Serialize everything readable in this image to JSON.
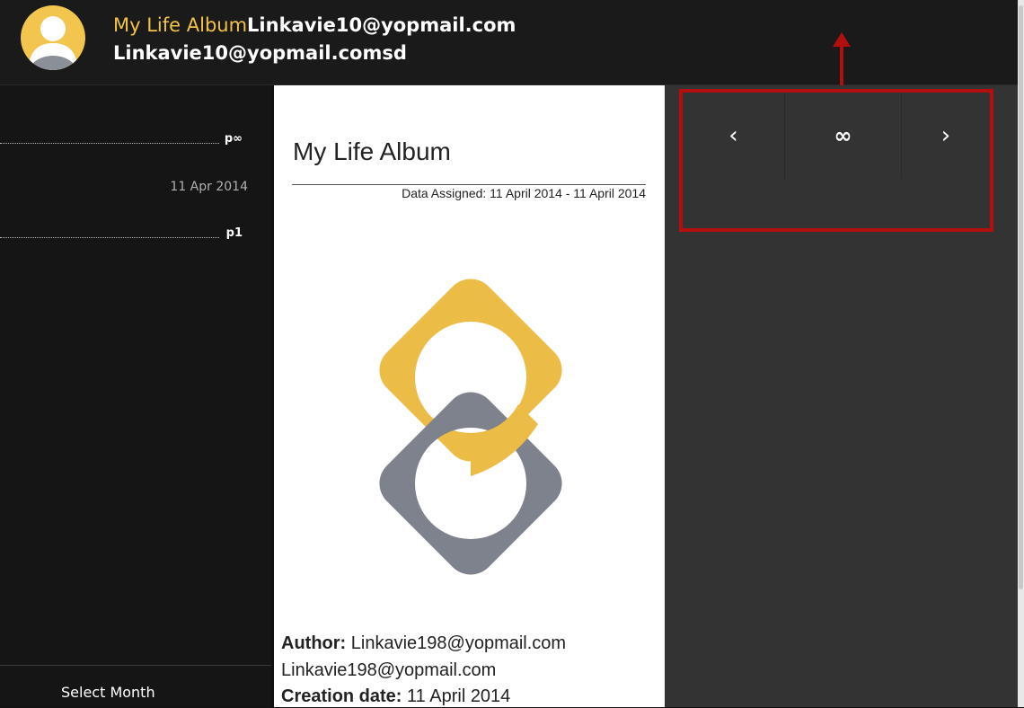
{
  "header": {
    "app_title": "My Life Album",
    "user_line1": "Linkavie10@yopmail.com",
    "user_line2": "Linkavie10@yopmail.comsd"
  },
  "sidebar": {
    "items": [
      {
        "label": "p∞"
      },
      {
        "label": "p1"
      }
    ],
    "date": "11 Apr 2014",
    "select_month": "Select Month"
  },
  "document": {
    "title": "My Life Album",
    "assigned": "Data Assigned: 11 April 2014 - 11 April 2014",
    "author_label": "Author:",
    "author_value": "Linkavie198@yopmail.com",
    "author_value2": "Linkavie198@yopmail.com",
    "creation_label": "Creation date:",
    "creation_value": "11 April 2014"
  },
  "nav": {
    "prev": "‹",
    "infinity": "∞",
    "next": "›"
  },
  "colors": {
    "accent_yellow": "#f3c343",
    "logo_gray": "#7e828c",
    "highlight_red": "#b30f0f"
  }
}
